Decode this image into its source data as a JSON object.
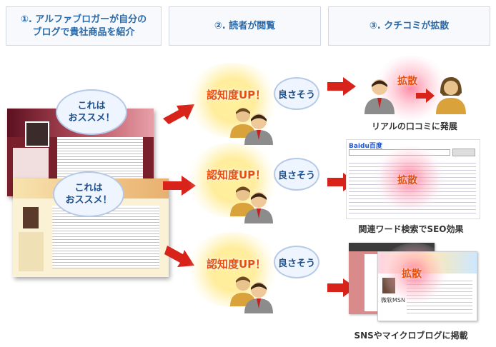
{
  "steps": [
    {
      "line1": "①. アルファブロガーが自分の",
      "line2": "ブログで貴社商品を紹介"
    },
    {
      "line1": "②. 読者が閲覧",
      "line2": ""
    },
    {
      "line1": "③. クチコミが拡散",
      "line2": ""
    }
  ],
  "blogger_bubble": "これは\nおススメ！",
  "awareness_text": "認知度UP！",
  "reader_bubble": "良さそう",
  "spread_label": "拡散",
  "search_logo": "Baidu百度",
  "sns_label": "微软MSN",
  "captions": {
    "row1": "リアルの口コミに発展",
    "row2": "関連ワード検索でSEO効果",
    "row3": "SNSやマイクロブログに掲載"
  },
  "colors": {
    "accent": "#2b6aa8",
    "arrow": "#d8231b",
    "burst_text": "#e4500f"
  }
}
